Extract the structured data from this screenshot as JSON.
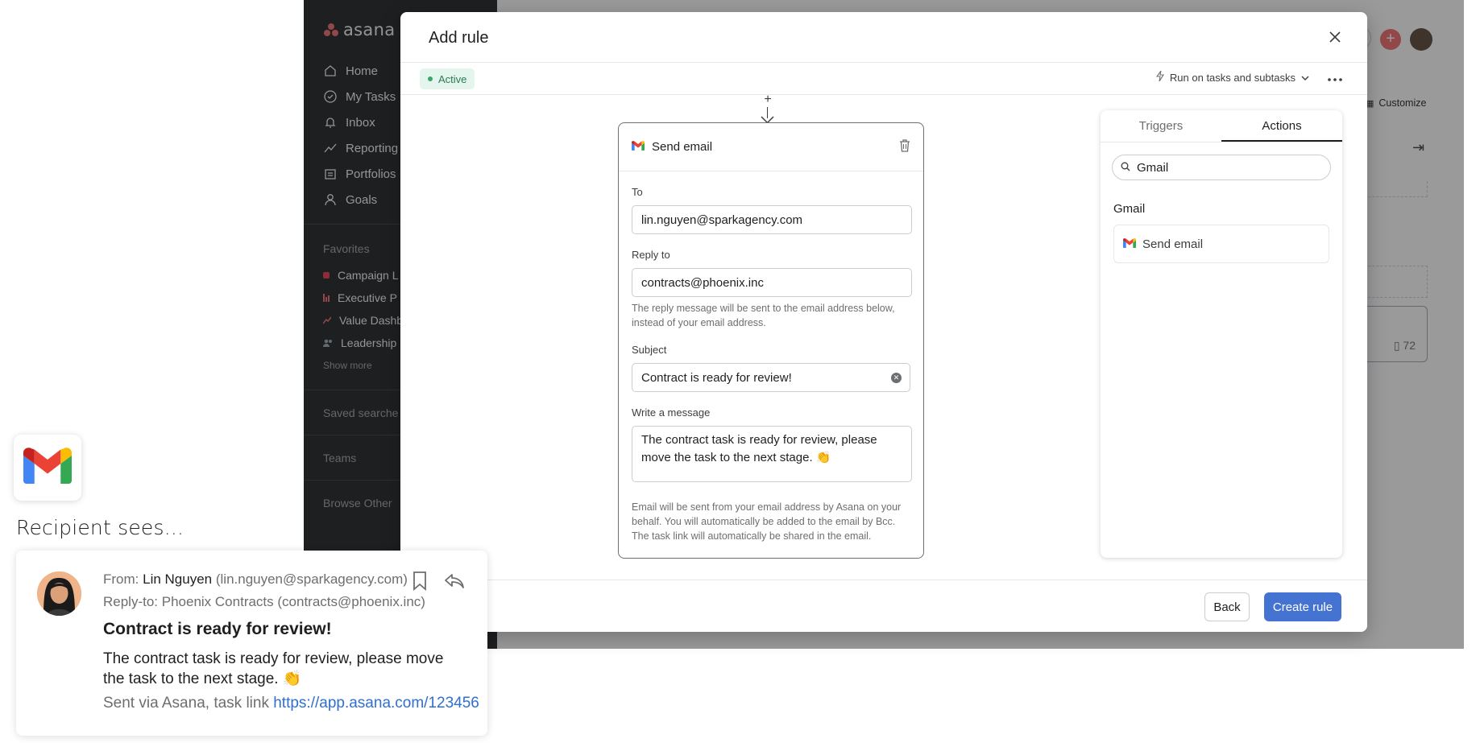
{
  "app": {
    "logo_text": "asana",
    "nav": [
      {
        "label": "Home",
        "icon": "home-icon"
      },
      {
        "label": "My Tasks",
        "icon": "check-circle-icon"
      },
      {
        "label": "Inbox",
        "icon": "bell-icon"
      },
      {
        "label": "Reporting",
        "icon": "trend-icon"
      },
      {
        "label": "Portfolios",
        "icon": "folder-icon"
      },
      {
        "label": "Goals",
        "icon": "person-icon"
      }
    ],
    "favorites_label": "Favorites",
    "favorites": [
      {
        "label": "Campaign L",
        "color": "#e8384f"
      },
      {
        "label": "Executive P",
        "color": "#f06a6a"
      },
      {
        "label": "Value Dashb",
        "color": "#f06a6a"
      },
      {
        "label": "Leadership",
        "color": "#9ca6af"
      }
    ],
    "show_more": "Show more",
    "saved_searches": "Saved searche",
    "teams": "Teams",
    "browse_other": "Browse Other",
    "customize": "Customize",
    "count_badge": "72"
  },
  "modal": {
    "title": "Add rule",
    "status": "Active",
    "run_on": "Run on tasks and subtasks",
    "card": {
      "title": "Send email",
      "to_label": "To",
      "to_value": "lin.nguyen@sparkagency.com",
      "reply_label": "Reply to",
      "reply_value": "contracts@phoenix.inc",
      "reply_hint": "The reply message will be sent to the email address below, instead of your email address.",
      "subject_label": "Subject",
      "subject_value": "Contract is ready for review!",
      "message_label": "Write a message",
      "message_value": "The contract task is ready for review, please move the task to the next stage. 👏",
      "footer_hint": "Email will be sent from your email address by Asana on your behalf. You will automatically be added to the email by Bcc. The task link will automatically be shared in the email."
    },
    "panel": {
      "tabs": [
        "Triggers",
        "Actions"
      ],
      "active_tab": "Actions",
      "search_value": "Gmail",
      "group_label": "Gmail",
      "result": "Send email"
    },
    "back_label": "Back",
    "create_label": "Create rule"
  },
  "promo": {
    "recipient_label": "Recipient sees...",
    "from_prefix": "From: ",
    "from_name": "Lin Nguyen",
    "from_email": " (lin.nguyen@sparkagency.com)",
    "reply_to": "Reply-to: Phoenix Contracts (contracts@phoenix.inc)",
    "subject": "Contract is ready for review!",
    "body": "The contract task is ready for review, please move the task to the next stage. 👏",
    "sent_via": "Sent via Asana, task link ",
    "task_link": "https://app.asana.com/123456"
  },
  "colors": {
    "accent": "#4573d2",
    "asana_coral": "#f06a6a",
    "active_green": "#3aa66a",
    "sidebar_bg": "#1e1f21"
  }
}
